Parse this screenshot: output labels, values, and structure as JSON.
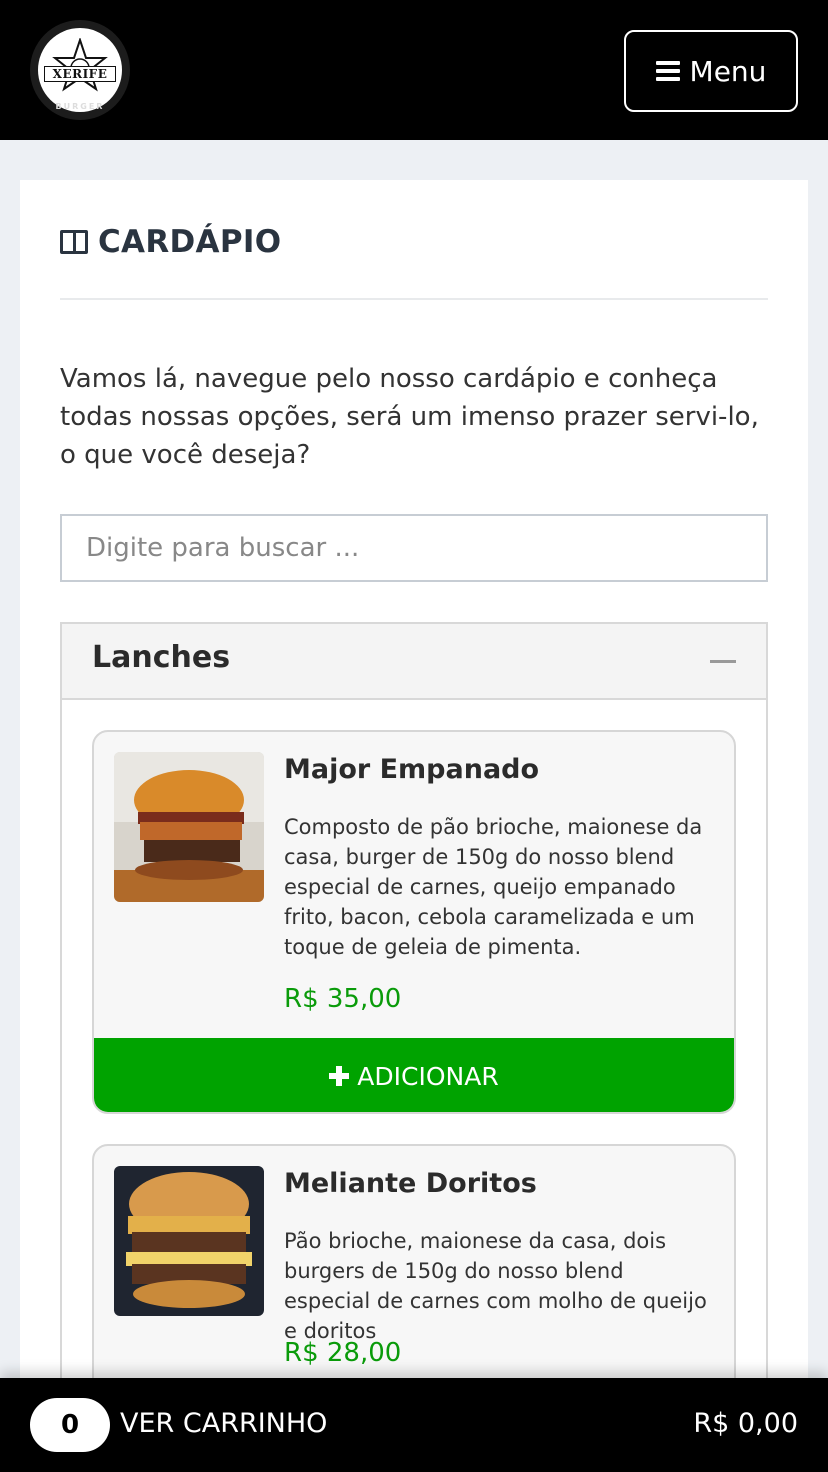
{
  "header": {
    "logo_text": "XERIFE",
    "logo_sub": "BURGER",
    "menu_label": "Menu"
  },
  "section": {
    "title": "CARDÁPIO",
    "intro": "Vamos lá, navegue pelo nosso cardápio e conheça todas nossas opções, será um imenso prazer servi-lo, o que você deseja?",
    "search_placeholder": "Digite para buscar ..."
  },
  "category": {
    "name": "Lanches",
    "items": [
      {
        "name": "Major Empanado",
        "description": "Composto de pão brioche, maionese da casa, burger de 150g do nosso blend especial de carnes, queijo empanado frito, bacon, cebola caramelizada e um toque de geleia de pimenta.",
        "price": "R$ 35,00",
        "add_label": "ADICIONAR"
      },
      {
        "name": "Meliante Doritos",
        "description": "Pão brioche, maionese da casa, dois burgers de 150g do nosso blend especial de carnes com molho de queijo e doritos",
        "price": "R$ 28,00"
      }
    ]
  },
  "cart": {
    "count": "0",
    "label": "VER CARRINHO",
    "total": "R$ 0,00"
  },
  "colors": {
    "accent_green": "#00a300",
    "price_green": "#0a9b0a",
    "header_bg": "#000000"
  }
}
